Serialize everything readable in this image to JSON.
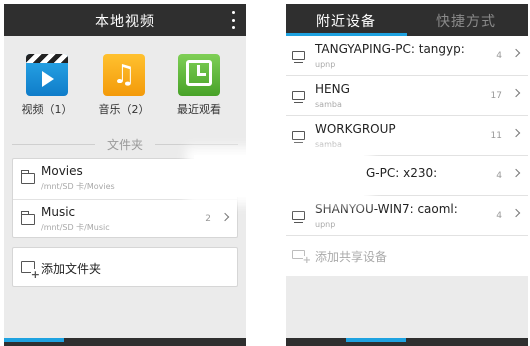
{
  "left": {
    "title": "本地视频",
    "categories": [
      {
        "label": "视频（1）",
        "icon": "video-icon"
      },
      {
        "label": "音乐（2）",
        "icon": "music-icon"
      },
      {
        "label": "最近观看",
        "icon": "recent-icon"
      }
    ],
    "section_title": "文件夹",
    "folders": [
      {
        "name": "Movies",
        "path": "/mnt/SD 卡/Movies",
        "count": ""
      },
      {
        "name": "Music",
        "path": "/mnt/SD 卡/Music",
        "count": "2"
      }
    ],
    "add_folder_label": "添加文件夹"
  },
  "right": {
    "tabs": [
      "附近设备",
      "快捷方式"
    ],
    "devices": [
      {
        "name": "TANGYAPING-PC: tangyp:",
        "protocol": "upnp",
        "count": "4"
      },
      {
        "name": "HENG",
        "protocol": "samba",
        "count": "17"
      },
      {
        "name": "WORKGROUP",
        "protocol": "samba",
        "count": "11"
      },
      {
        "name": "G-PC: x230:",
        "protocol": "",
        "count": "4"
      },
      {
        "name": "SHANYOU-WIN7: caoml:",
        "protocol": "upnp",
        "count": "4"
      }
    ],
    "add_share_label": "添加共享设备"
  },
  "colors": {
    "accent": "#1ea2e0",
    "bar": "#2f2f2f",
    "background": "#ebebeb"
  }
}
